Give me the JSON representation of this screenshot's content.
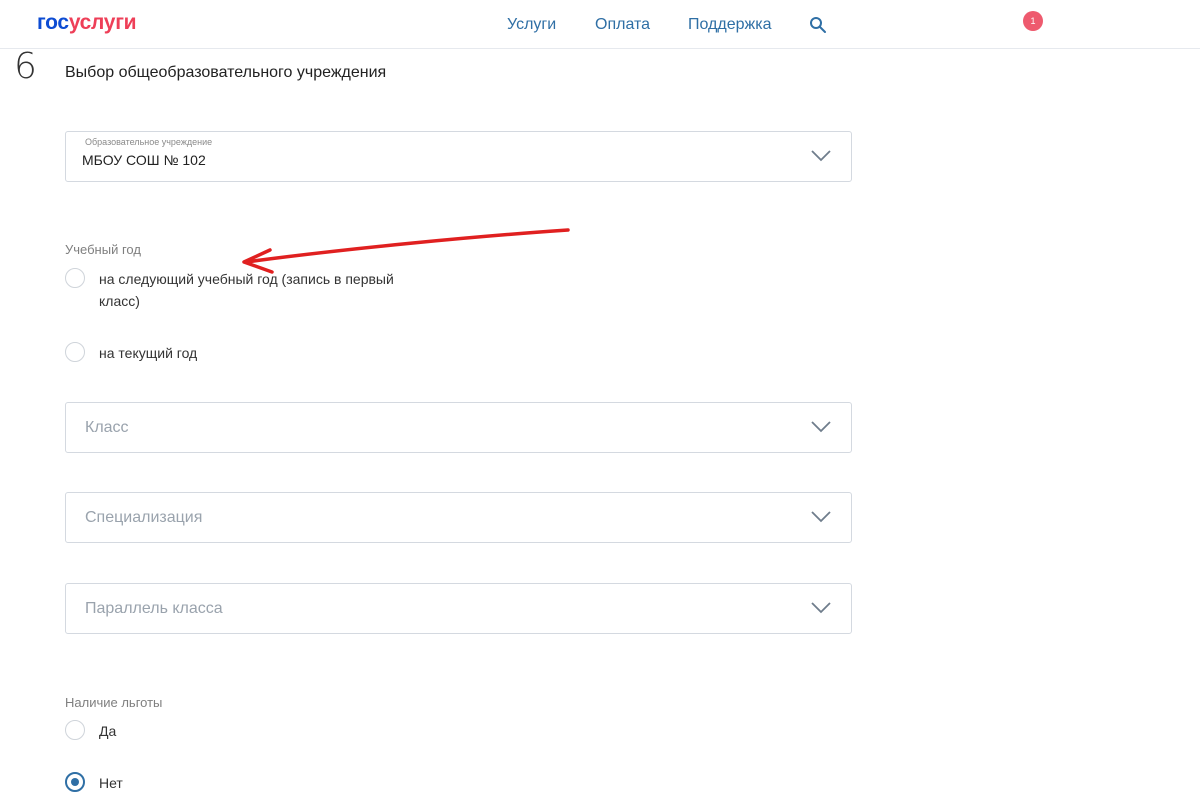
{
  "header": {
    "logo_part1": "гос",
    "logo_part2": "услуги",
    "nav": [
      "Услуги",
      "Оплата",
      "Поддержка"
    ],
    "notification_count": "1"
  },
  "form": {
    "step_number": "6",
    "section_title": "Выбор общеобразовательного учреждения",
    "institution": {
      "label": "Образовательное учреждение",
      "value": "МБОУ СОШ № 102"
    },
    "school_year": {
      "label": "Учебный год",
      "options": [
        "на следующий учебный год (запись в первый класс)",
        "на текущий год"
      ]
    },
    "class_placeholder": "Класс",
    "specialization_placeholder": "Специализация",
    "parallel_placeholder": "Параллель класса",
    "benefit": {
      "label": "Наличие льготы",
      "options": [
        "Да",
        "Нет"
      ],
      "selected": "Нет"
    }
  },
  "colors": {
    "brand_blue": "#0d4cd3",
    "brand_red": "#ee3f58",
    "link_blue": "#2f6fa5",
    "annotation_arrow": "#e02020"
  }
}
